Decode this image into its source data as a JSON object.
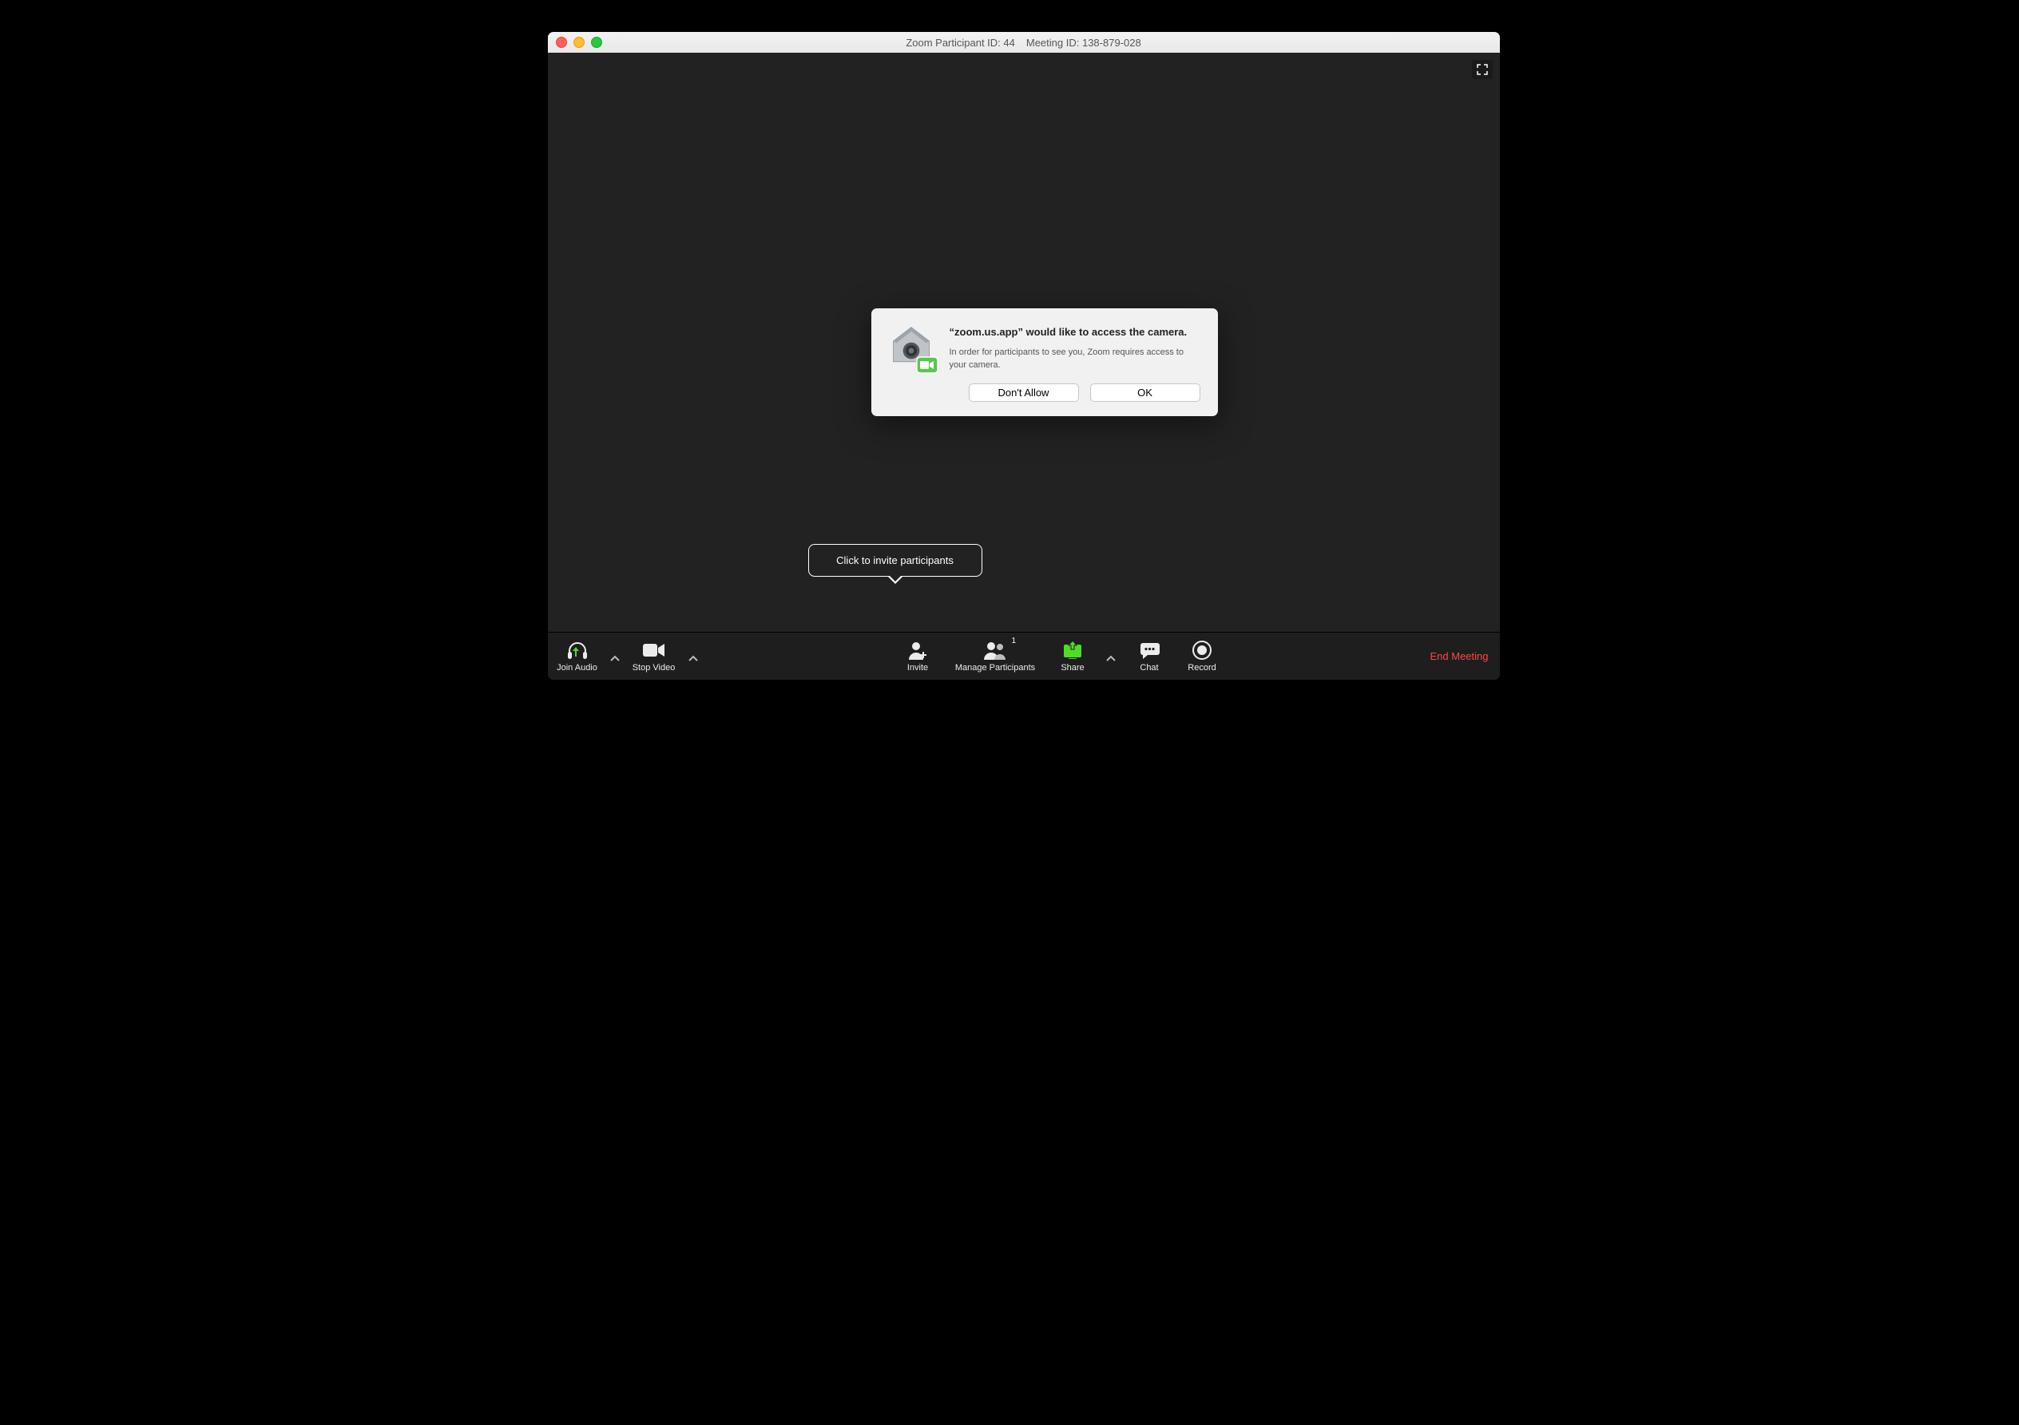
{
  "titlebar": {
    "participant": "Zoom Participant ID: 44",
    "meeting": "Meeting ID: 138-879-028"
  },
  "dialog": {
    "title": "“zoom.us.app” would like to access the camera.",
    "message": "In order for participants to see you, Zoom requires access to your camera.",
    "dont_allow": "Don't Allow",
    "ok": "OK"
  },
  "tooltip": {
    "invite": "Click to invite participants"
  },
  "toolbar": {
    "join_audio": "Join Audio",
    "stop_video": "Stop Video",
    "invite": "Invite",
    "manage_participants": "Manage Participants",
    "participants_count": "1",
    "share": "Share",
    "chat": "Chat",
    "record": "Record",
    "end_meeting": "End Meeting"
  },
  "colors": {
    "share_green": "#4fdc24",
    "end_red": "#ff4747"
  }
}
